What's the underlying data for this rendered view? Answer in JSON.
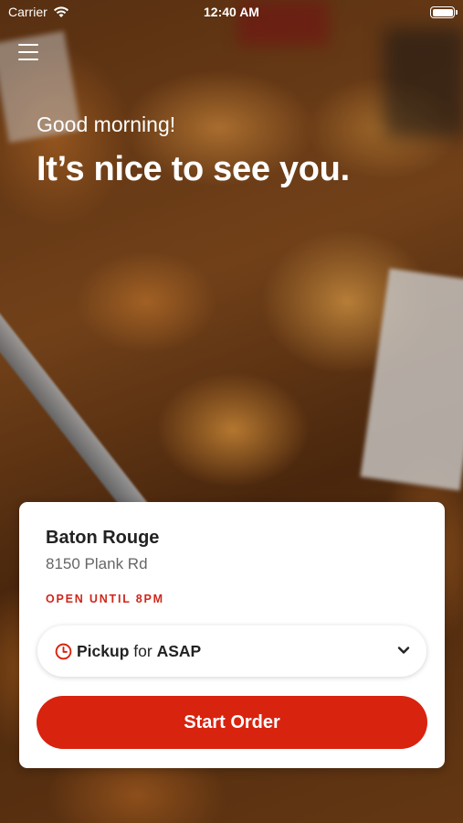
{
  "status_bar": {
    "carrier": "Carrier",
    "time": "12:40 AM"
  },
  "greeting": "Good morning!",
  "headline": "It’s nice to see you.",
  "store": {
    "name": "Baton Rouge",
    "address": "8150 Plank Rd",
    "hours": "OPEN UNTIL 8PM"
  },
  "order": {
    "mode": "Pickup",
    "connector": "for",
    "time": "ASAP",
    "start_label": "Start Order"
  },
  "colors": {
    "accent": "#d8230f",
    "hours_text": "#d0261a"
  }
}
